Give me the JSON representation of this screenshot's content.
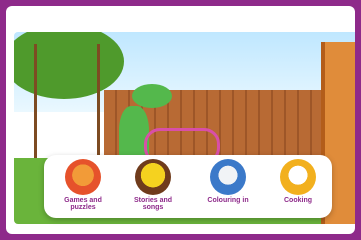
{
  "menu": {
    "items": [
      {
        "label": "Games and\npuzzles",
        "icon": "puzzle-icon"
      },
      {
        "label": "Stories and\nsongs",
        "icon": "music-note-icon"
      },
      {
        "label": "Colouring in",
        "icon": "paint-brush-icon"
      },
      {
        "label": "Cooking",
        "icon": "cooking-pot-icon"
      }
    ]
  },
  "colors": {
    "frame": "#8e2a8a",
    "accent": "#8e2a8a"
  }
}
